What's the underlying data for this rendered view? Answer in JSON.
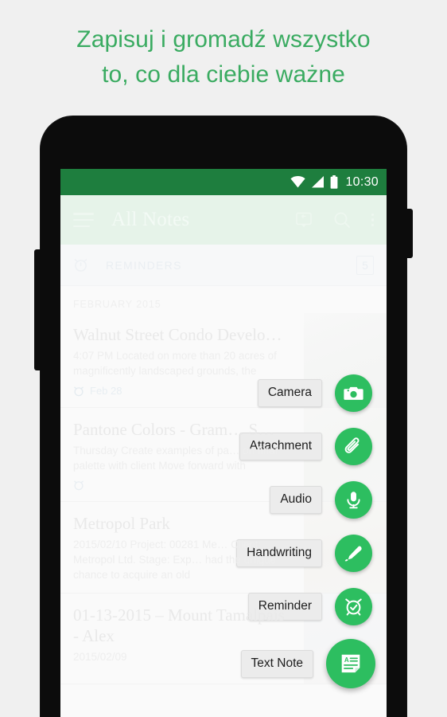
{
  "headline": {
    "line1": "Zapisuj i gromadź wszystko",
    "line2": "to, co dla ciebie ważne",
    "color": "#3aab61"
  },
  "status_bar": {
    "time": "10:30",
    "icons": [
      "wifi-icon",
      "cell-signal-icon",
      "battery-icon"
    ],
    "background": "#1e7e3e"
  },
  "app_bar": {
    "title": "All Notes",
    "menu_icon": "hamburger-menu-icon",
    "actions": [
      "work-chat-icon",
      "search-icon",
      "overflow-menu-icon"
    ],
    "background": "#e6f3e9"
  },
  "reminders": {
    "icon": "alarm-clock-icon",
    "label": "REMINDERS",
    "count": "5"
  },
  "notes": {
    "month_header": "FEBRUARY 2015",
    "items": [
      {
        "title": "Walnut Street Condo Develo…",
        "snippet": "4:07 PM Located on more than 20 acres of magnificently landscaped grounds, the",
        "date": "Feb 28",
        "reminder_icon": "alarm-clock-icon"
      },
      {
        "title": "Pantone Colors - Gram… S…",
        "snippet": "Thursday Create examples of pa… on final palette with client Move forward with",
        "date": "",
        "reminder_icon": "alarm-clock-icon"
      },
      {
        "title": "Metropol Park",
        "snippet": "2015/02/10 Project: 00281 Me… Client: Metropol Ltd. Stage: Exp… had the unique chance to acquire an old",
        "date": "",
        "reminder_icon": ""
      },
      {
        "title": "01-13-2015 – Mount Tamalpais - Alex",
        "snippet": "2015/02/09",
        "date": "",
        "reminder_icon": ""
      }
    ]
  },
  "fab_menu": {
    "accent_color": "#2dbe60",
    "items": [
      {
        "label": "Camera",
        "icon": "camera-icon"
      },
      {
        "label": "Attachment",
        "icon": "paperclip-icon"
      },
      {
        "label": "Audio",
        "icon": "microphone-icon"
      },
      {
        "label": "Handwriting",
        "icon": "pen-icon"
      },
      {
        "label": "Reminder",
        "icon": "alarm-clock-icon"
      },
      {
        "label": "Text Note",
        "icon": "text-note-icon"
      }
    ]
  }
}
